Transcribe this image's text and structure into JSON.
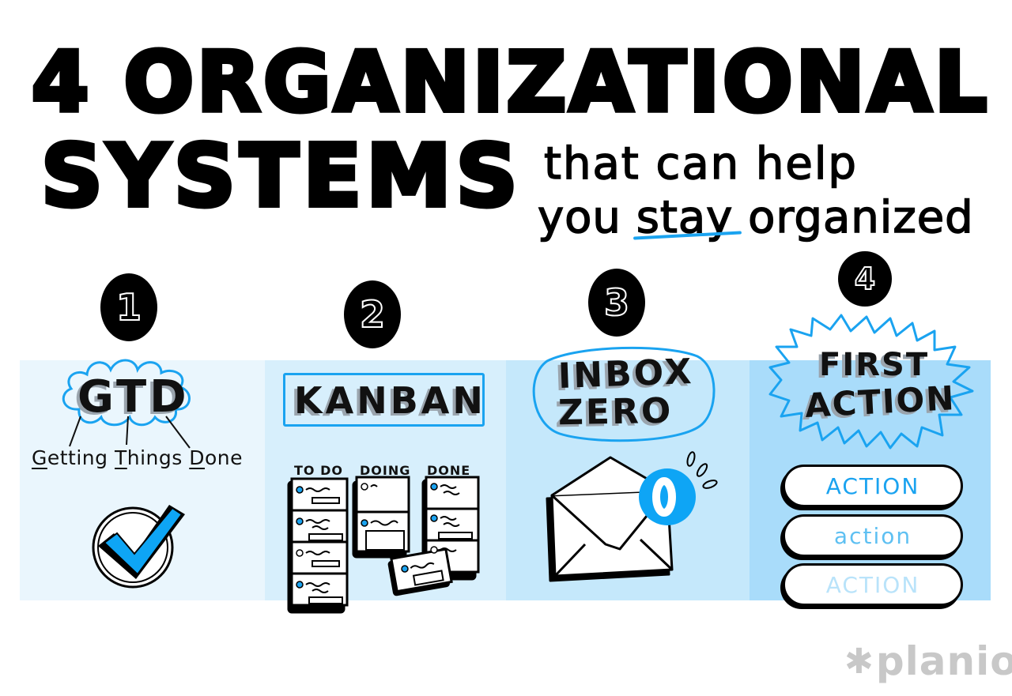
{
  "title": {
    "line1": "4 ORGANIZATIONAL",
    "line2": "SYSTEMS"
  },
  "subtitle": {
    "line1": "that can help",
    "line2_pre": "you ",
    "line2_highlight": "stay",
    "line2_post": " organized",
    "highlight_color": "#1aa3f0"
  },
  "systems": [
    {
      "number": "1",
      "name": "GTD",
      "expansion": {
        "words": [
          {
            "initial": "G",
            "rest": "etting"
          },
          {
            "initial": "T",
            "rest": "hings"
          },
          {
            "initial": "D",
            "rest": "one"
          }
        ]
      },
      "icon": "checkmark-icon",
      "panel_color": "#eaf6fd"
    },
    {
      "number": "2",
      "name": "KANBAN",
      "columns": [
        "TO DO",
        "DOING",
        "DONE"
      ],
      "icon": "kanban-board-icon",
      "panel_color": "#d7effc"
    },
    {
      "number": "3",
      "name_line1": "INBOX",
      "name_line2": "ZERO",
      "badge_count": "0",
      "icon": "envelope-icon",
      "panel_color": "#c5e8fb"
    },
    {
      "number": "4",
      "name_line1": "FIRST",
      "name_line2": "ACTION",
      "actions": [
        "ACTION",
        "action",
        "ACTION"
      ],
      "panel_color": "#a9dcfa"
    }
  ],
  "brand": {
    "logo_text": "planio",
    "logo_symbol": "✱"
  },
  "colors": {
    "accent": "#1aa3f0",
    "ink": "#000000",
    "logo_gray": "#c8c8c8"
  }
}
